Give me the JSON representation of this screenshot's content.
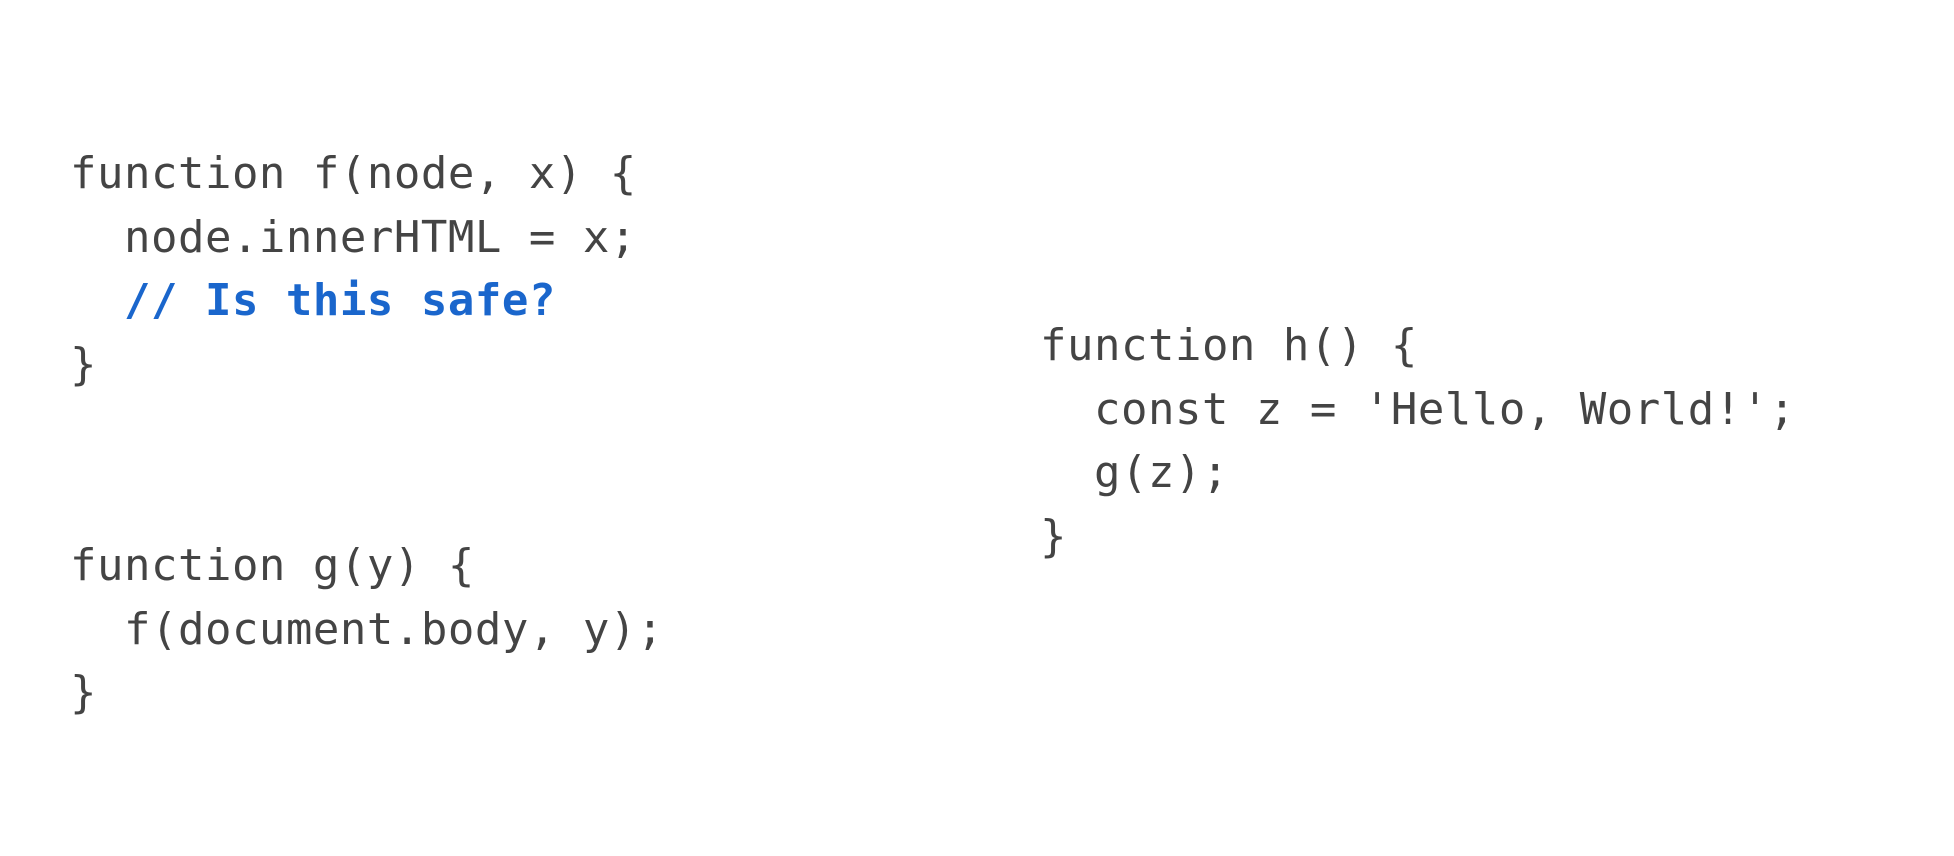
{
  "code": {
    "f": {
      "l1": "function f(node, x) {",
      "l2": "  node.innerHTML = x;",
      "l3": "  // Is this safe?",
      "l4": "}"
    },
    "g": {
      "l1": "function g(y) {",
      "l2": "  f(document.body, y);",
      "l3": "}"
    },
    "h": {
      "l1": "function h() {",
      "l2": "  const z = 'Hello, World!';",
      "l3": "  g(z);",
      "l4": "}"
    }
  }
}
